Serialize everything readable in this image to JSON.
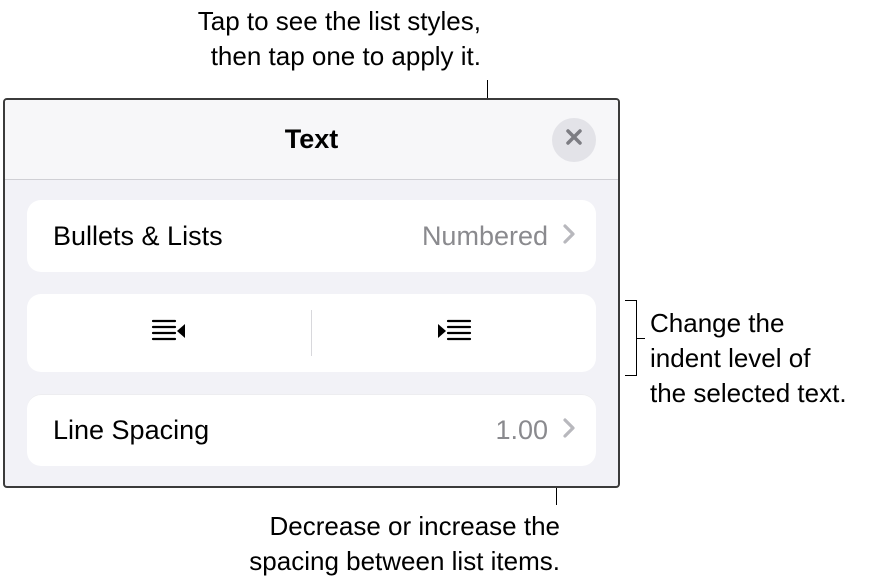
{
  "callouts": {
    "top": "Tap to see the list styles,\nthen tap one to apply it.",
    "right": "Change the\nindent level of\nthe selected text.",
    "bottom": "Decrease or increase the\nspacing between list items."
  },
  "panel": {
    "title": "Text",
    "bullets_lists": {
      "label": "Bullets & Lists",
      "value": "Numbered"
    },
    "line_spacing": {
      "label": "Line Spacing",
      "value": "1.00"
    }
  }
}
